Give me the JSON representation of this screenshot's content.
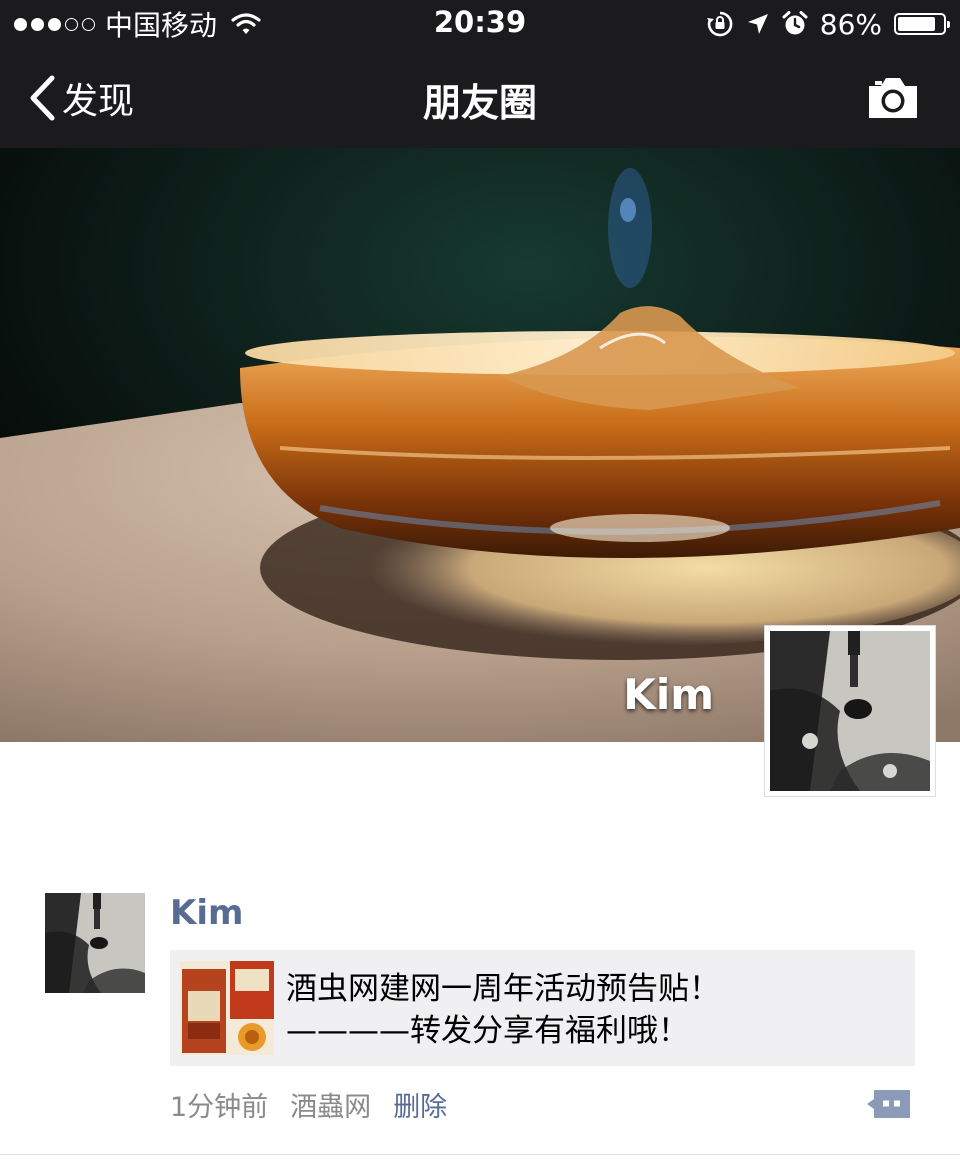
{
  "status_bar": {
    "carrier": "中国移动",
    "time": "20:39",
    "battery_percent": "86%",
    "battery_level": 0.86,
    "icons": [
      "signal-dots-icon",
      "wifi-icon",
      "orientation-lock-icon",
      "location-arrow-icon",
      "alarm-icon",
      "battery-icon"
    ]
  },
  "nav_bar": {
    "back_label": "发现",
    "title": "朋友圈",
    "right_icon": "camera-icon"
  },
  "cover": {
    "user_name": "Kim"
  },
  "post": {
    "author": "Kim",
    "share": {
      "line1": "酒虫网建网一周年活动预告贴！",
      "line2": "————转发分享有福利哦！"
    },
    "time_ago": "1分钟前",
    "source": "酒蟲网",
    "delete_label": "删除",
    "comment_icon": "comment-dots-icon"
  },
  "colors": {
    "bar_background": "#1b1b1d",
    "author_link": "#576b95",
    "card_background": "#f0f0f2",
    "meta_text": "#8a8a8a"
  }
}
